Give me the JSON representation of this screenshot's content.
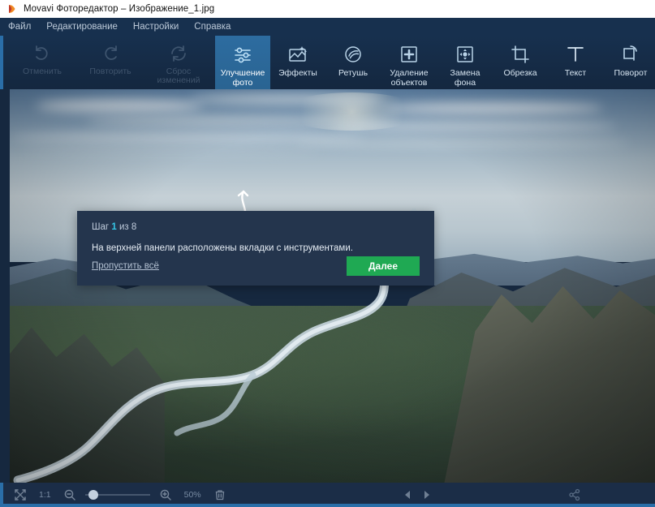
{
  "window": {
    "title": "Movavi Фоторедактор – Изображение_1.jpg",
    "app_icon": "movavi-logo-icon"
  },
  "menubar": {
    "items": [
      {
        "label": "Файл",
        "name": "menu-file"
      },
      {
        "label": "Редактирование",
        "name": "menu-edit"
      },
      {
        "label": "Настройки",
        "name": "menu-settings"
      },
      {
        "label": "Справка",
        "name": "menu-help"
      }
    ]
  },
  "toolbar": {
    "history": [
      {
        "label": "Отменить",
        "icon": "undo-icon",
        "disabled": true
      },
      {
        "label": "Повторить",
        "icon": "redo-icon",
        "disabled": true
      },
      {
        "label": "Сброс\nизменений",
        "icon": "reset-icon",
        "disabled": true
      }
    ],
    "tabs": [
      {
        "label": "Улучшение\nфото",
        "icon": "sliders-icon",
        "active": true
      },
      {
        "label": "Эффекты",
        "icon": "effects-icon",
        "active": false
      },
      {
        "label": "Ретушь",
        "icon": "retouch-icon",
        "active": false
      },
      {
        "label": "Удаление\nобъектов",
        "icon": "object-removal-icon",
        "active": false
      },
      {
        "label": "Замена\nфона",
        "icon": "background-replace-icon",
        "active": false
      },
      {
        "label": "Обрезка",
        "icon": "crop-icon",
        "active": false
      },
      {
        "label": "Текст",
        "icon": "text-icon",
        "active": false
      },
      {
        "label": "Поворот",
        "icon": "rotate-icon",
        "active": false
      }
    ]
  },
  "tooltip": {
    "step_prefix": "Шаг",
    "step_current": "1",
    "step_middle": "из",
    "step_total": "8",
    "body": "На верхней панели расположены вкладки с инструментами.",
    "skip_label": "Пропустить всё",
    "next_label": "Далее",
    "next_color": "#1fa953",
    "background": "#24354d",
    "step_highlight_color": "#35c7e6"
  },
  "statusbar": {
    "fit_icon": "fit-to-screen-icon",
    "actual_size_label": "1:1",
    "zoom_out_icon": "zoom-out-icon",
    "zoom_in_icon": "zoom-in-icon",
    "zoom_level": "50%",
    "delete_icon": "trash-icon",
    "prev_icon": "previous-image-icon",
    "next_icon": "next-image-icon",
    "share_icon": "share-icon"
  },
  "canvas": {
    "image_name": "Изображение_1.jpg",
    "alt": "Аэрофотоснимок извилистой реки в горной долине"
  },
  "theme": {
    "accent": "#2a6ea8",
    "panel": "#17304e",
    "panel_dark": "#14273f",
    "tab_active": "#2d6ca0",
    "text": "#d6e4f0",
    "text_dim": "#8fa2b8"
  }
}
